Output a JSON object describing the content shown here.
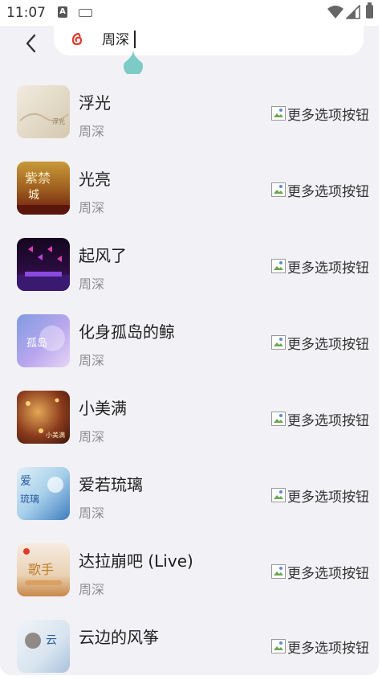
{
  "status_bar": {
    "time": "11:07",
    "notification_icon": "A",
    "icons": [
      "keyboard-icon",
      "wifi-icon",
      "signal-icon",
      "battery-icon"
    ]
  },
  "search": {
    "query": "周深",
    "logo_icon": "netease-music-icon",
    "back_icon": "back-arrow-icon"
  },
  "songs": [
    {
      "title": "浮光",
      "artist": "周深",
      "more_label": "更多选项按钮",
      "cover_colors": [
        "#efe8dc",
        "#d9ccb4"
      ]
    },
    {
      "title": "光亮",
      "artist": "周深",
      "more_label": "更多选项按钮",
      "cover_colors": [
        "#b88a2c",
        "#7a2a12"
      ]
    },
    {
      "title": "起风了",
      "artist": "周深",
      "more_label": "更多选项按钮",
      "cover_colors": [
        "#1a0a2e",
        "#6a1b9a"
      ]
    },
    {
      "title": "化身孤岛的鲸",
      "artist": "周深",
      "more_label": "更多选项按钮",
      "cover_colors": [
        "#8ea8e8",
        "#c7b6f0"
      ]
    },
    {
      "title": "小美满",
      "artist": "周深",
      "more_label": "更多选项按钮",
      "cover_colors": [
        "#6b2e1a",
        "#d39a4a"
      ]
    },
    {
      "title": "爱若琉璃",
      "artist": "周深",
      "more_label": "更多选项按钮",
      "cover_colors": [
        "#cfe6f2",
        "#4a86c8"
      ]
    },
    {
      "title": "达拉崩吧 (Live)",
      "artist": "周深",
      "more_label": "更多选项按钮",
      "cover_colors": [
        "#f3e6d6",
        "#c98a3a"
      ]
    },
    {
      "title": "云边的风筝",
      "artist": "周深",
      "more_label": "更多选项按钮",
      "cover_colors": [
        "#e8eef4",
        "#3b6fa8"
      ]
    }
  ]
}
